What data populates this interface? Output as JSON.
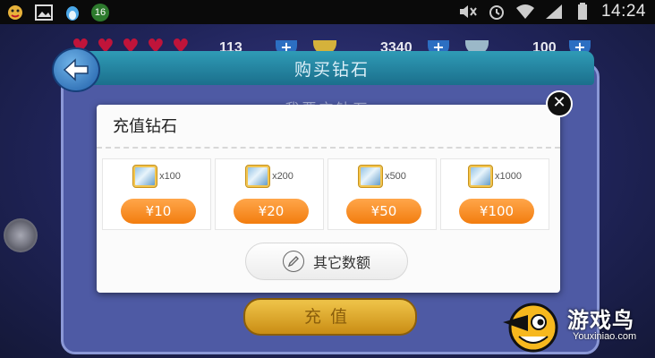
{
  "status_bar": {
    "notification_badge": "16",
    "clock": "14:24",
    "icons": [
      "qq-icon",
      "gallery-icon",
      "penguin-icon",
      "notification-badge",
      "mute-icon",
      "alarm-icon",
      "wifi-icon",
      "signal-icon",
      "battery-icon"
    ]
  },
  "hud": {
    "value_1": "113",
    "value_2": "3340",
    "value_3": "100"
  },
  "buy_panel": {
    "title": "购买钻石",
    "behind_text": "我要充钻石",
    "recharge_button": "充值"
  },
  "dialog": {
    "title": "充值钻石",
    "options": [
      {
        "quantity": "x100",
        "price": "¥10"
      },
      {
        "quantity": "x200",
        "price": "¥20"
      },
      {
        "quantity": "x500",
        "price": "¥50"
      },
      {
        "quantity": "x1000",
        "price": "¥100"
      }
    ],
    "other_amount": "其它数额",
    "close_symbol": "✕"
  },
  "watermark": {
    "brand": "游戏鸟",
    "url": "Youxiniao.com"
  },
  "colors": {
    "accent_orange": "#f27d0f",
    "panel_blue": "#4e5aa4",
    "header_teal": "#1b6f8c"
  }
}
